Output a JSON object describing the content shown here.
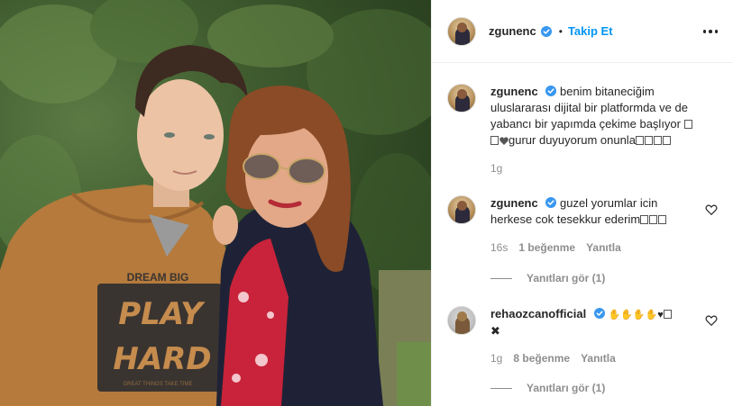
{
  "post": {
    "username": "zgunenc",
    "follow_label": "Takip Et",
    "separator": "•"
  },
  "comments": [
    {
      "username": "zgunenc",
      "text": "benim bitaneciğim uluslararası dijital bir platformda ve de yabancı bir yapımda çekime başlıyor ",
      "text2": "gurur duyuyorum onunla",
      "time": "1g"
    },
    {
      "username": "zgunenc",
      "text": "guzel yorumlar icin herkese cok tesekkur ederim",
      "time": "16s",
      "likes": "1 beğenme",
      "reply_label": "Yanıtla",
      "view_replies": "Yanıtları gör (1)"
    },
    {
      "username": "rehaozcanofficial",
      "text": "✖",
      "time": "1g",
      "likes": "8 beğenme",
      "reply_label": "Yanıtla",
      "view_replies": "Yanıtları gör (1)"
    }
  ],
  "photo": {
    "shirt_text_top": "DREAM BIG",
    "shirt_text_main1": "PLAY",
    "shirt_text_main2": "HARD",
    "shirt_text_small": "GREAT THINGS TAKE TIME"
  },
  "colors": {
    "follow": "#0095f6",
    "verified": "#3897f0",
    "muted": "#8e8e8e"
  },
  "icons": [
    "verified-badge-icon",
    "more-options-icon",
    "heart-icon"
  ]
}
